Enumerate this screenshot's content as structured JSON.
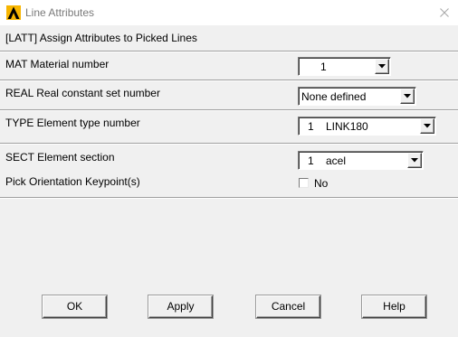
{
  "window": {
    "title": "Line Attributes",
    "command": "[LATT]  Assign Attributes to Picked Lines"
  },
  "fields": {
    "mat": {
      "label": "MAT   Material number",
      "value": "1"
    },
    "real": {
      "label": "REAL  Real constant set number",
      "value": "None defined"
    },
    "type": {
      "label": "TYPE  Element type number",
      "value": "1    LINK180"
    },
    "sect": {
      "label": "SECT  Element section",
      "value": "1    acel"
    },
    "orient": {
      "label": "Pick Orientation Keypoint(s)",
      "checkbox_label": "No",
      "checked": false
    }
  },
  "buttons": {
    "ok": "OK",
    "apply": "Apply",
    "cancel": "Cancel",
    "help": "Help"
  },
  "icons": {
    "app": "ansys-logo-icon",
    "close": "close-icon",
    "dropdown": "chevron-down-icon"
  },
  "colors": {
    "logo_yellow": "#f7b500",
    "logo_black": "#000000",
    "title_text": "#7a7a7a",
    "dialog_bg": "#f0f0f0"
  }
}
